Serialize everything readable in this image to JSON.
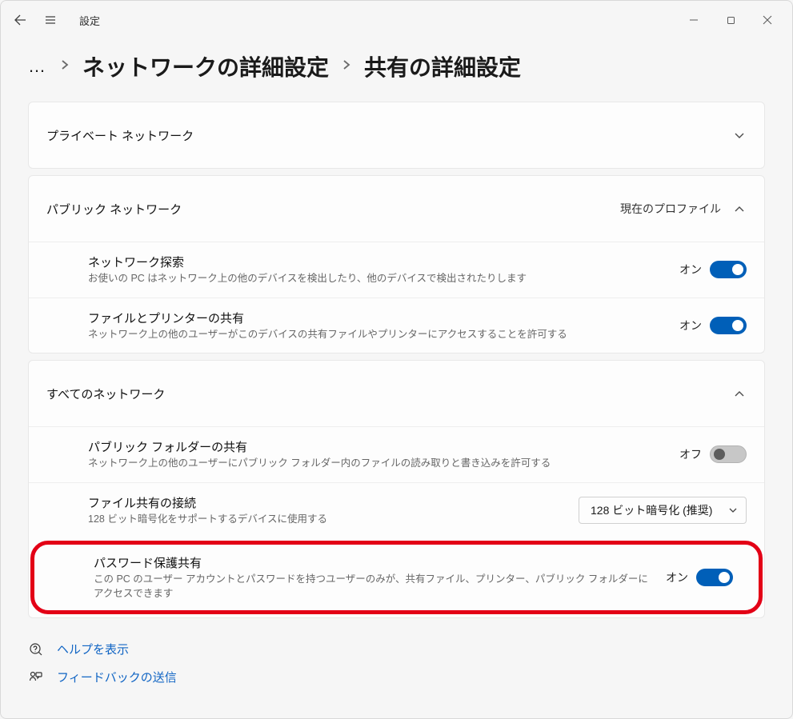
{
  "app": {
    "title": "設定"
  },
  "breadcrumb": {
    "ellipsis": "…",
    "parent": "ネットワークの詳細設定",
    "current": "共有の詳細設定"
  },
  "panels": {
    "private": {
      "title": "プライベート ネットワーク"
    },
    "public": {
      "title": "パブリック ネットワーク",
      "badge": "現在のプロファイル",
      "network_discovery": {
        "title": "ネットワーク探索",
        "desc": "お使いの PC はネットワーク上の他のデバイスを検出したり、他のデバイスで検出されたりします",
        "state": "オン"
      },
      "file_printer_sharing": {
        "title": "ファイルとプリンターの共有",
        "desc": "ネットワーク上の他のユーザーがこのデバイスの共有ファイルやプリンターにアクセスすることを許可する",
        "state": "オン"
      }
    },
    "all": {
      "title": "すべてのネットワーク",
      "public_folder_sharing": {
        "title": "パブリック フォルダーの共有",
        "desc": "ネットワーク上の他のユーザーにパブリック フォルダー内のファイルの読み取りと書き込みを許可する",
        "state": "オフ"
      },
      "file_sharing_conn": {
        "title": "ファイル共有の接続",
        "desc": "128 ビット暗号化をサポートするデバイスに使用する",
        "selected": "128 ビット暗号化 (推奨)"
      },
      "password_protected": {
        "title": "パスワード保護共有",
        "desc": "この PC のユーザー アカウントとパスワードを持つユーザーのみが、共有ファイル、プリンター、パブリック フォルダーにアクセスできます",
        "state": "オン"
      }
    }
  },
  "footer": {
    "help": "ヘルプを表示",
    "feedback": "フィードバックの送信"
  }
}
